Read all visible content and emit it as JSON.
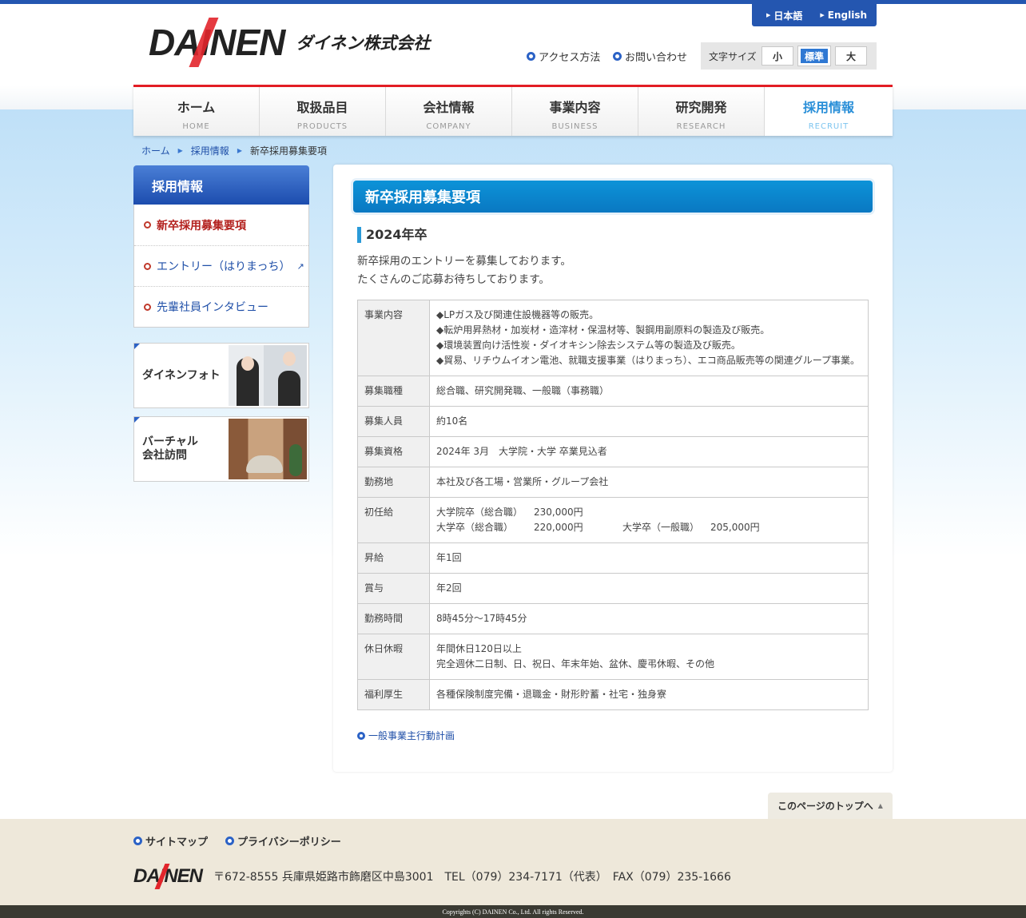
{
  "header": {
    "logo_mark": "DAINEN",
    "logo_text": "ダイネン株式会社",
    "lang_ja": "日本語",
    "lang_en": "English",
    "access": "アクセス方法",
    "contact": "お問い合わせ",
    "fontsize_label": "文字サイズ",
    "fontsize_small": "小",
    "fontsize_normal": "標準",
    "fontsize_large": "大"
  },
  "nav": [
    {
      "jp": "ホーム",
      "en": "HOME"
    },
    {
      "jp": "取扱品目",
      "en": "PRODUCTS"
    },
    {
      "jp": "会社情報",
      "en": "COMPANY"
    },
    {
      "jp": "事業内容",
      "en": "BUSINESS"
    },
    {
      "jp": "研究開発",
      "en": "RESEARCH"
    },
    {
      "jp": "採用情報",
      "en": "RECRUIT"
    }
  ],
  "breadcrumb": {
    "home": "ホーム",
    "recruit": "採用情報",
    "current": "新卒採用募集要項"
  },
  "sidebar": {
    "title": "採用情報",
    "items": [
      {
        "label": "新卒採用募集要項"
      },
      {
        "label": "エントリー（はりまっち）"
      },
      {
        "label": "先輩社員インタビュー"
      }
    ],
    "banner1": "ダイネンフォト",
    "banner2_line1": "バーチャル",
    "banner2_line2": "会社訪問"
  },
  "main": {
    "title": "新卒採用募集要項",
    "subtitle": "2024年卒",
    "lead1": "新卒採用のエントリーを募集しております。",
    "lead2": "たくさんのご応募お待ちしております。",
    "table": {
      "business": {
        "label": "事業内容",
        "lines": [
          "◆LPガス及び関連住設機器等の販売。",
          "◆転炉用昇熱材・加炭材・造滓材・保温材等、製鋼用副原料の製造及び販売。",
          "◆環境装置向け活性炭・ダイオキシン除去システム等の製造及び販売。",
          "◆貿易、リチウムイオン電池、就職支援事業（はりまっち）、エコ商品販売等の関連グループ事業。"
        ]
      },
      "job": {
        "label": "募集職種",
        "value": "総合職、研究開発職、一般職（事務職）"
      },
      "count": {
        "label": "募集人員",
        "value": "約10名"
      },
      "qual": {
        "label": "募集資格",
        "value": "2024年 3月　大学院・大学 卒業見込者"
      },
      "place": {
        "label": "勤務地",
        "value": "本社及び各工場・営業所・グループ会社"
      },
      "salary": {
        "label": "初任給",
        "l1a": "大学院卒（総合職）",
        "l1b": "230,000円",
        "l2a": "大学卒（総合職）",
        "l2b": "220,000円",
        "l2c": "大学卒（一般職）",
        "l2d": "205,000円"
      },
      "raise": {
        "label": "昇給",
        "value": "年1回"
      },
      "bonus": {
        "label": "賞与",
        "value": "年2回"
      },
      "hours": {
        "label": "勤務時間",
        "value": "8時45分～17時45分"
      },
      "holiday": {
        "label": "休日休暇",
        "l1": "年間休日120日以上",
        "l2": "完全週休二日制、日、祝日、年末年始、盆休、慶弔休暇、その他"
      },
      "welfare": {
        "label": "福利厚生",
        "value": "各種保険制度完備・退職金・財形貯蓄・社宅・独身寮"
      }
    },
    "plan_link": "一般事業主行動計画"
  },
  "pagetop": "このページのトップへ",
  "footer": {
    "sitemap": "サイトマップ",
    "privacy": "プライバシーポリシー",
    "logo": "DAINEN",
    "address": "〒672-8555 兵庫県姫路市飾磨区中島3001　TEL（079）234-7171（代表）　FAX（079）235-1666",
    "copyright": "Copyrights (C) DAINEN Co., Ltd. All rights Reserved."
  },
  "colors": {
    "brand_blue": "#2456b0",
    "accent_red": "#e21d24",
    "title_blue": "#0c93d8"
  }
}
